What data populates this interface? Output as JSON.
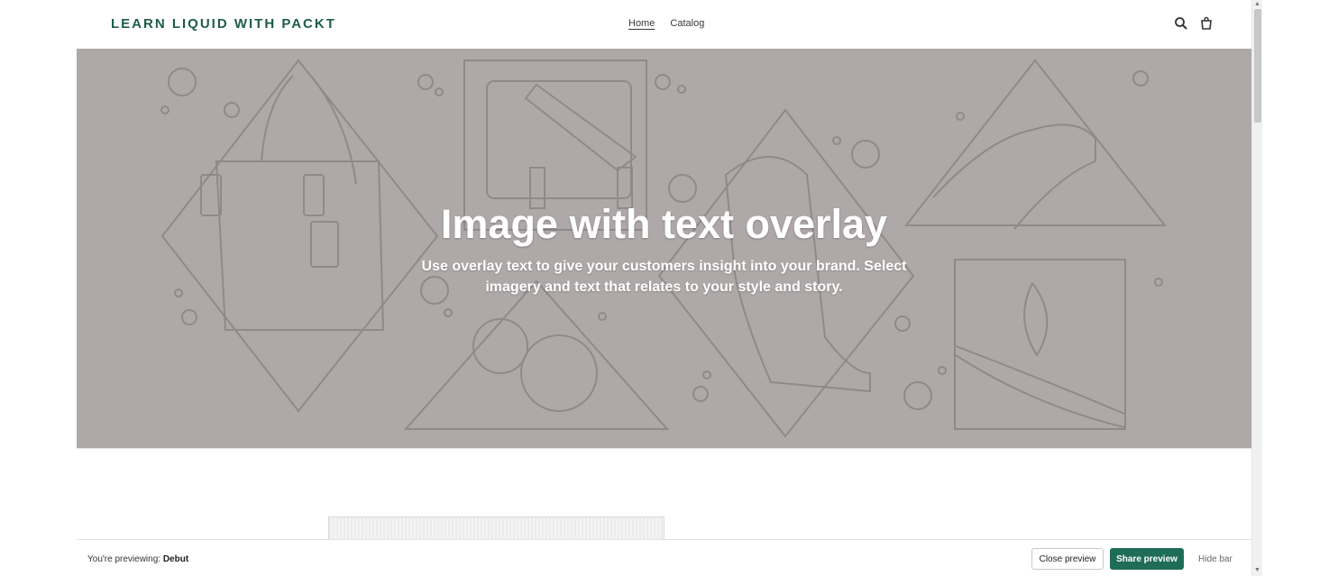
{
  "header": {
    "logo": "LEARN LIQUID WITH PACKT",
    "nav": [
      {
        "label": "Home",
        "active": true
      },
      {
        "label": "Catalog",
        "active": false
      }
    ],
    "icons": [
      "search-icon",
      "cart-icon"
    ]
  },
  "hero": {
    "title": "Image with text overlay",
    "subtitle": "Use overlay text to give your customers insight into your brand. Select imagery and text that relates to your style and story.",
    "background_color": "#afa8a8"
  },
  "preview_bar": {
    "prefix": "You're previewing:",
    "theme": "Debut",
    "close_label": "Close preview",
    "share_label": "Share preview",
    "hide_label": "Hide bar",
    "accent_color": "#1f6d57"
  }
}
